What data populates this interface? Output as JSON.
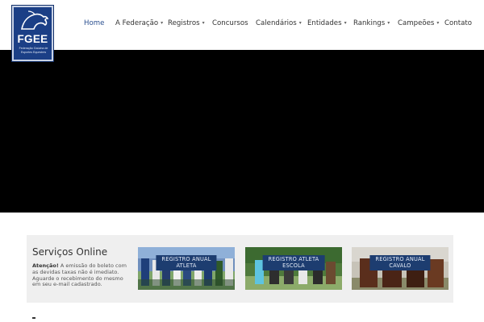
{
  "logo": {
    "abbr": "FGEE",
    "subtitle": "Federação Gaúcha de Esportes Equestres"
  },
  "nav": {
    "items": [
      {
        "label": "Home",
        "active": true,
        "dropdown": false
      },
      {
        "label": "A Federação",
        "dropdown": true
      },
      {
        "label": "Registros",
        "dropdown": true
      },
      {
        "label": "Concursos",
        "dropdown": false
      },
      {
        "label": "Calendários",
        "dropdown": true
      },
      {
        "label": "Entidades",
        "dropdown": true
      },
      {
        "label": "Rankings",
        "dropdown": true
      },
      {
        "label": "Campeões",
        "dropdown": true
      },
      {
        "label": "Contato",
        "dropdown": false
      }
    ],
    "caret": "▾"
  },
  "services": {
    "title": "Serviços Online",
    "note_bold": "Atenção!",
    "note_text": " A emissão do boleto com as devidas taxas não é imediato. Aguarde o recebimento do mesmo em seu e-mail cadastrado.",
    "cards": [
      {
        "line1": "REGISTRO ANUAL",
        "line2": "ATLETA"
      },
      {
        "line1": "REGISTRO ATLETA",
        "line2": "ESCOLA"
      },
      {
        "line1": "REGISTRO ANUAL",
        "line2": "CAVALO"
      }
    ]
  },
  "colors": {
    "brand": "#1b3f86",
    "nav_active": "#2a4f8f",
    "card_button": "#1d3d70",
    "hero": "#000000",
    "services_bg": "#efefef"
  }
}
